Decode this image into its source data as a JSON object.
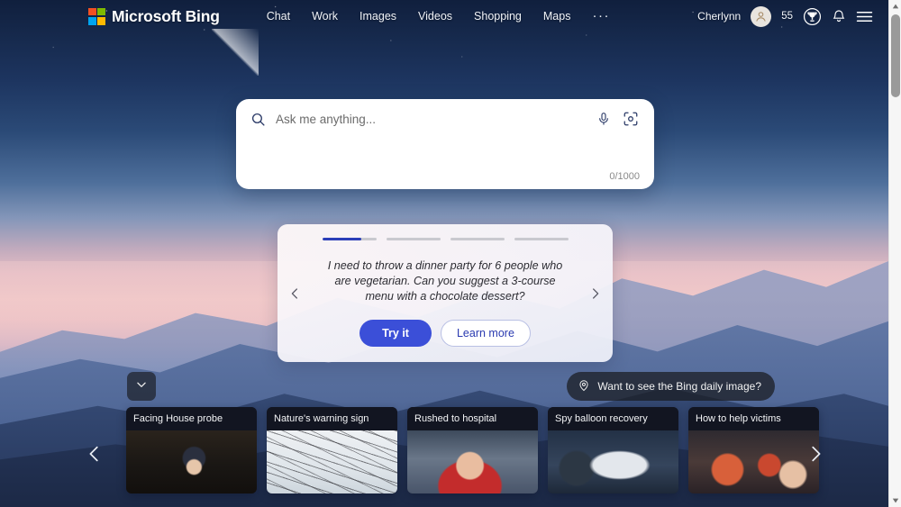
{
  "header": {
    "brand": "Microsoft Bing",
    "logo_icon": "microsoft-squares-logo",
    "nav_items": [
      {
        "label": "Chat"
      },
      {
        "label": "Work"
      },
      {
        "label": "Images"
      },
      {
        "label": "Videos"
      },
      {
        "label": "Shopping"
      },
      {
        "label": "Maps"
      }
    ],
    "more_label": "···",
    "user_name": "Cherlynn",
    "avatar_icon": "user-avatar-icon",
    "rewards_points": "55",
    "rewards_icon": "trophy-icon",
    "notifications_icon": "bell-icon",
    "menu_icon": "hamburger-menu-icon"
  },
  "search": {
    "placeholder": "Ask me anything...",
    "value": "",
    "search_icon": "search-icon",
    "mic_icon": "microphone-icon",
    "visual_search_icon": "visual-search-icon",
    "char_count": "0/1000"
  },
  "promo": {
    "progress": [
      {
        "fill_percent": "72%"
      },
      {
        "fill_percent": "0%"
      },
      {
        "fill_percent": "0%"
      },
      {
        "fill_percent": "0%"
      }
    ],
    "suggestion": "I need to throw a dinner party for 6 people who are vegetarian. Can you suggest a 3-course menu with a chocolate dessert?",
    "primary_label": "Try it",
    "secondary_label": "Learn more",
    "prev_icon": "chevron-left-icon",
    "next_icon": "chevron-right-icon",
    "accent_color": "#3b4fd8"
  },
  "daily_image": {
    "label": "Want to see the Bing daily image?",
    "pin_icon": "location-pin-icon"
  },
  "collapse": {
    "icon": "chevron-down-icon"
  },
  "news": {
    "prev_icon": "chevron-left-icon",
    "next_icon": "chevron-right-icon",
    "cards": [
      {
        "title": "Facing House probe",
        "photo": "photo-1"
      },
      {
        "title": "Nature's warning sign",
        "photo": "photo-2"
      },
      {
        "title": "Rushed to hospital",
        "photo": "photo-3"
      },
      {
        "title": "Spy balloon recovery",
        "photo": "photo-4"
      },
      {
        "title": "How to help victims",
        "photo": "photo-5"
      }
    ]
  },
  "scrollbar": {
    "up_icon": "scroll-up-arrow-icon",
    "down_icon": "scroll-down-arrow-icon"
  }
}
